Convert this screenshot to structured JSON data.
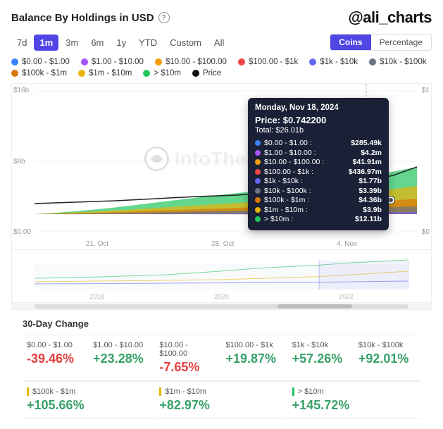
{
  "header": {
    "title": "Balance By Holdings in USD",
    "brand": "@ali_charts",
    "info_icon": "?"
  },
  "time_buttons": [
    {
      "label": "7d",
      "active": false
    },
    {
      "label": "1m",
      "active": true
    },
    {
      "label": "3m",
      "active": false
    },
    {
      "label": "6m",
      "active": false
    },
    {
      "label": "1y",
      "active": false
    },
    {
      "label": "YTD",
      "active": false
    },
    {
      "label": "Custom",
      "active": false
    },
    {
      "label": "All",
      "active": false
    }
  ],
  "view_buttons": [
    {
      "label": "Coins",
      "active": true
    },
    {
      "label": "Percentage",
      "active": false
    }
  ],
  "legend": [
    {
      "color": "#3b82f6",
      "label": "$0.00 - $1.00"
    },
    {
      "color": "#a855f7",
      "label": "$1.00 - $10.00"
    },
    {
      "color": "#f59e0b",
      "label": "$10.00 - $100.00"
    },
    {
      "color": "#ef4444",
      "label": "$100.00 - $1k"
    },
    {
      "color": "#6366f1",
      "label": "$1k - $10k"
    },
    {
      "color": "#6b7280",
      "label": "$10k - $100k"
    },
    {
      "color": "#d97706",
      "label": "$100k - $1m"
    },
    {
      "color": "#eab308",
      "label": "$1m - $10m"
    },
    {
      "color": "#22c55e",
      "label": "> $10m"
    },
    {
      "color": "#111",
      "label": "Price"
    }
  ],
  "y_axis_left": [
    "$16b",
    "$8b",
    "$0.00"
  ],
  "y_axis_right": [
    "$1",
    "$0"
  ],
  "x_axis": [
    "21. Oct",
    "28. Oct",
    "4. Nov"
  ],
  "mini_x_axis": [
    "2018",
    "2020",
    "2022"
  ],
  "watermark": "IntoTheBlock",
  "tooltip": {
    "date": "Monday, Nov 18, 2024",
    "price_label": "Price:",
    "price_value": "$0.742200",
    "total_label": "Total:",
    "total_value": "$26.01b",
    "rows": [
      {
        "color": "#3b82f6",
        "label": "$0.00 - $1.00 :",
        "value": "$285.49k"
      },
      {
        "color": "#a855f7",
        "label": "$1.00 - $10.00 :",
        "value": "$4.2m"
      },
      {
        "color": "#f59e0b",
        "label": "$10.00 - $100.00 :",
        "value": "$41.91m"
      },
      {
        "color": "#ef4444",
        "label": "$100.00 - $1k :",
        "value": "$436.97m"
      },
      {
        "color": "#6366f1",
        "label": "$1k - $10k :",
        "value": "$1.77b"
      },
      {
        "color": "#6b7280",
        "label": "$10k - $100k :",
        "value": "$3.39b"
      },
      {
        "color": "#d97706",
        "label": "$100k - $1m :",
        "value": "$4.36b"
      },
      {
        "color": "#eab308",
        "label": "$1m - $10m :",
        "value": "$3.9b"
      },
      {
        "color": "#22c55e",
        "label": "> $10m :",
        "value": "$12.11b"
      }
    ]
  },
  "change_section": {
    "title": "30-Day Change",
    "cells": [
      {
        "range": "$0.00 - $1.00",
        "value": "-39.46%",
        "type": "neg"
      },
      {
        "range": "$1.00 - $10.00",
        "value": "+23.28%",
        "type": "pos"
      },
      {
        "range": "$10.00 - $100.00",
        "value": "-7.65%",
        "type": "neg"
      },
      {
        "range": "$100.00 - $1k",
        "value": "+19.87%",
        "type": "pos"
      },
      {
        "range": "$1k - $10k",
        "value": "+57.26%",
        "type": "pos"
      },
      {
        "range": "$10k - $100k",
        "value": "+92.01%",
        "type": "pos"
      }
    ],
    "cells2": [
      {
        "range": "$100k - $1m",
        "value": "+105.66%",
        "type": "pos",
        "accent": "#eab308"
      },
      {
        "range": "$1m - $10m",
        "value": "+82.97%",
        "type": "pos",
        "accent": "#eab308"
      },
      {
        "range": "> $10m",
        "value": "+145.72%",
        "type": "pos",
        "accent": "#22c55e"
      }
    ]
  }
}
